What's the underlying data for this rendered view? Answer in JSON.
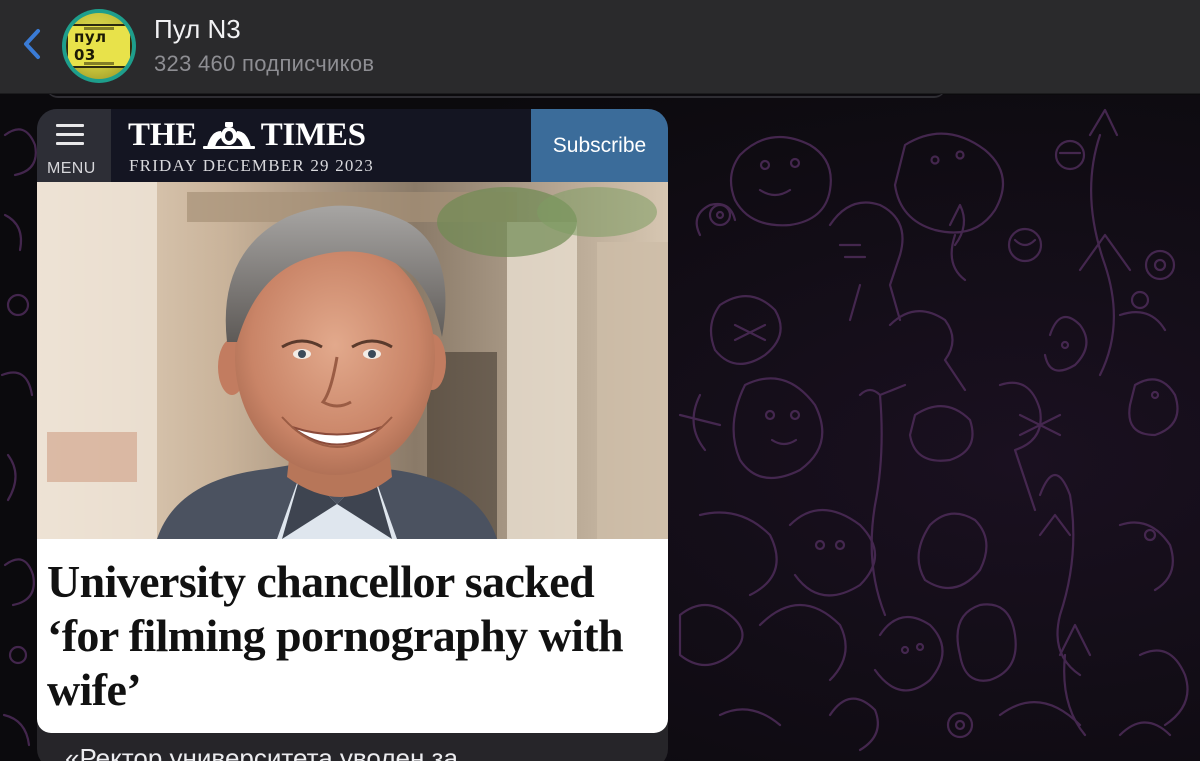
{
  "header": {
    "channel_name": "Пул N3",
    "subscribers": "323 460 подписчиков",
    "avatar_plate_text": "пул 03",
    "back_icon": "chevron-left-icon",
    "accent_color": "#3a7bd5"
  },
  "post": {
    "times_header": {
      "menu_label": "MENU",
      "logo_left": "THE",
      "logo_right": "TIMES",
      "date": "FRIDAY DECEMBER 29 2023",
      "subscribe_label": "Subscribe",
      "subscribe_color": "#3b6c9a"
    },
    "headline": "University chancellor sacked ‘for filming pornography with wife’",
    "caption_partial": "«Ректор университета уволен за"
  }
}
